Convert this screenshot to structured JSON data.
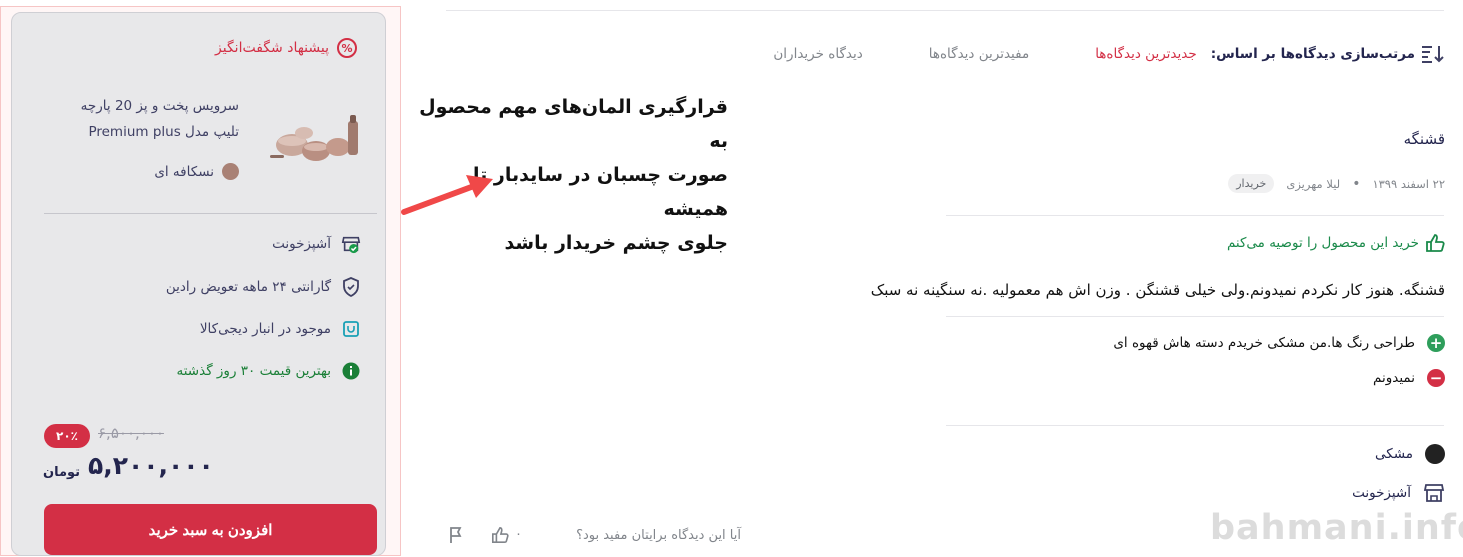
{
  "sidebar": {
    "title": "پیشنهاد شگفت‌انگیز",
    "title_icon": "percent-icon",
    "product_name_line1": "سرویس پخت و پز 20 پارچه",
    "product_name_line2": "تلیپ مدل Premium plus",
    "product_color": "نسکافه ای",
    "product_color_hex": "#a98175",
    "seller": "آشپزخونت",
    "warranty": "گارانتی ۲۴ ماهه تعویض رادین",
    "stock": "موجود در انبار دیجی‌کالا",
    "best_price": "بهترین قیمت ۳۰ روز گذشته",
    "old_price": "۶,۵۰۰,۰۰۰",
    "discount": "۲۰٪",
    "price": "۵,۲۰۰,۰۰۰",
    "currency": "تومان",
    "add_to_cart": "افزودن به سبد خرید",
    "accent_color": "#d32f45"
  },
  "annotation": {
    "text_line1": "قرارگیری المان‌های مهم محصول به",
    "text_line2": "صورت چسبان در سایدبار تا همیشه",
    "text_line3": "جلوی چشم خریدار باشد"
  },
  "sort": {
    "label": "مرتب‌سازی دیدگاه‌ها بر اساس:",
    "options": [
      "جدیدترین دیدگاه‌ها",
      "مفیدترین دیدگاه‌ها",
      "دیدگاه خریداران"
    ],
    "active": "جدیدترین دیدگاه‌ها"
  },
  "review": {
    "title": "قشنگه",
    "date": "۲۲ اسفند ۱۳۹۹",
    "author": "لیلا مهریزی",
    "badge": "خریدار",
    "recommend": "خرید این محصول را توصیه می‌کنم",
    "body": "قشنگه. هنوز کار نکردم نمیدونم.ولی خیلی قشنگن . وزن اش هم معمولیه .نه سنگینه نه سبک",
    "pro": "طراحی رنگ ها.من مشکی خریدم دسته هاش قهوه ای",
    "con": "نمیدونم",
    "variant_color": "مشکی",
    "variant_seller": "آشپزخونت",
    "helpful_question": "آیا این دیدگاه برایتان مفید بود؟",
    "like_count": "۰"
  },
  "watermark": "bahmani.info"
}
